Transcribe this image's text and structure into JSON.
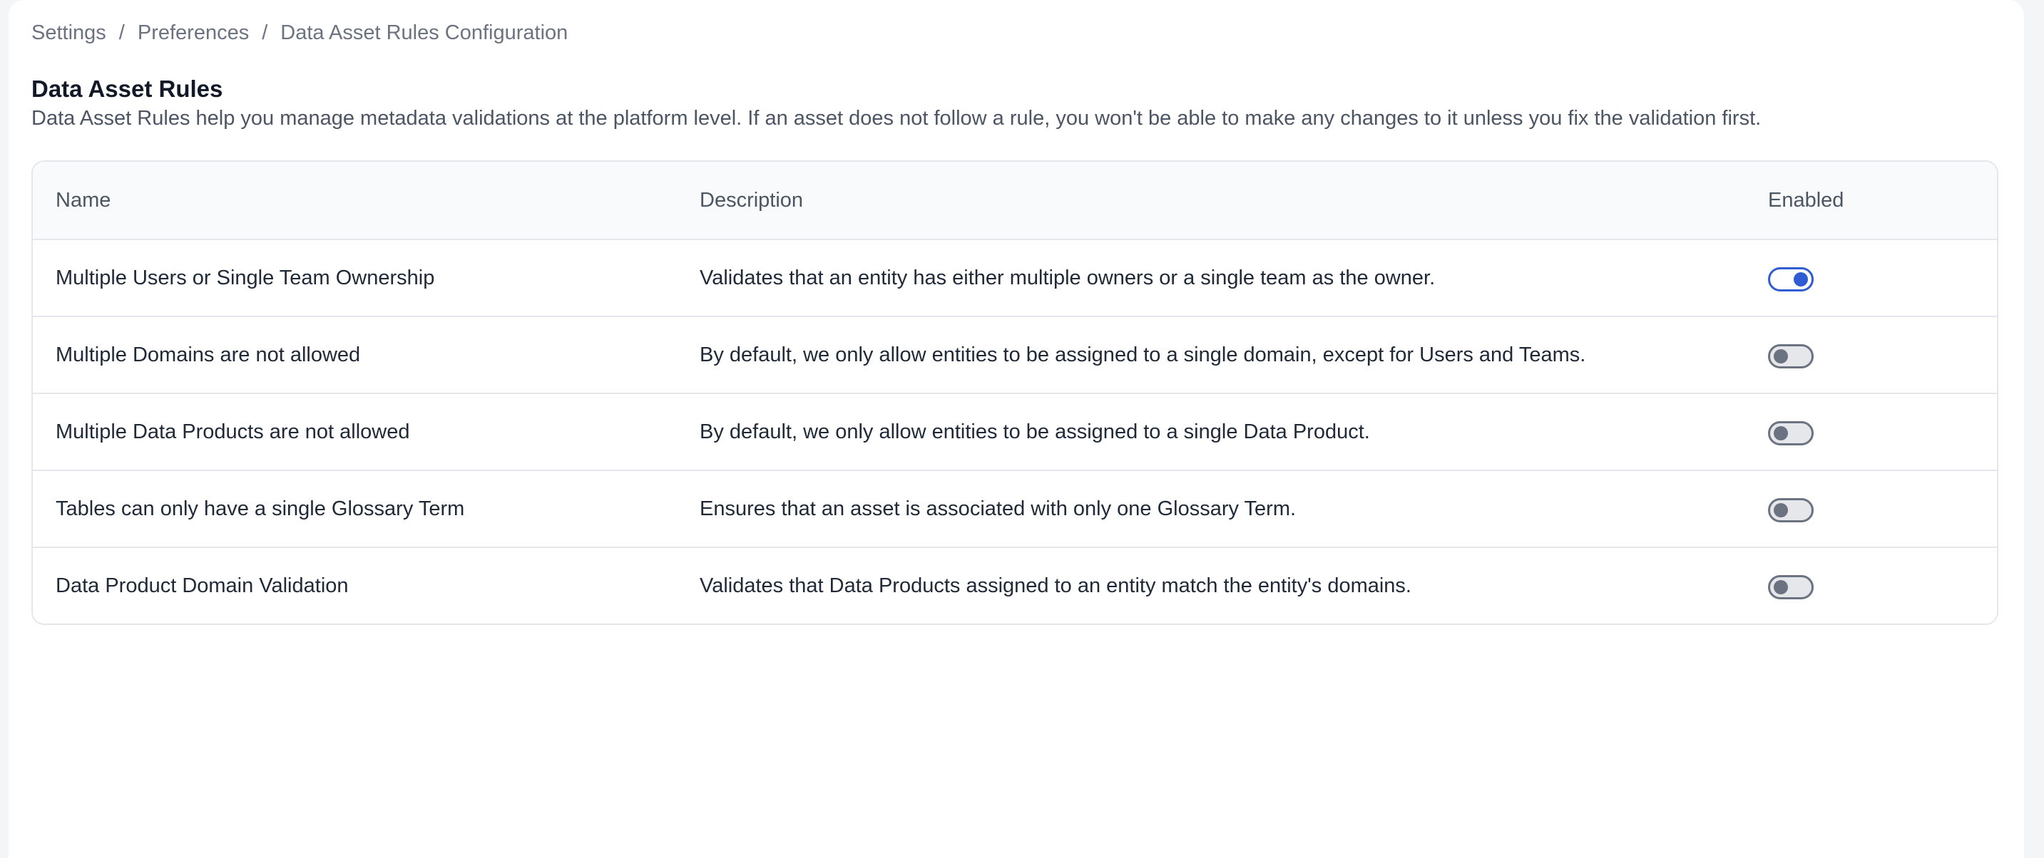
{
  "breadcrumb": {
    "items": [
      "Settings",
      "Preferences",
      "Data Asset Rules Configuration"
    ],
    "separator": "/"
  },
  "page": {
    "title": "Data Asset Rules",
    "description": "Data Asset Rules help you manage metadata validations at the platform level. If an asset does not follow a rule, you won't be able to make any changes to it unless you fix the validation first."
  },
  "table": {
    "headers": {
      "name": "Name",
      "description": "Description",
      "enabled": "Enabled"
    },
    "rows": [
      {
        "name": "Multiple Users or Single Team Ownership",
        "description": "Validates that an entity has either multiple owners or a single team as the owner.",
        "enabled": true
      },
      {
        "name": "Multiple Domains are not allowed",
        "description": "By default, we only allow entities to be assigned to a single domain, except for Users and Teams.",
        "enabled": false
      },
      {
        "name": "Multiple Data Products are not allowed",
        "description": "By default, we only allow entities to be assigned to a single Data Product.",
        "enabled": false
      },
      {
        "name": "Tables can only have a single Glossary Term",
        "description": "Ensures that an asset is associated with only one Glossary Term.",
        "enabled": false
      },
      {
        "name": "Data Product Domain Validation",
        "description": "Validates that Data Products assigned to an entity match the entity's domains.",
        "enabled": false
      }
    ]
  },
  "colors": {
    "toggle_on": "#2f5bd3",
    "toggle_off": "#6b7280"
  }
}
